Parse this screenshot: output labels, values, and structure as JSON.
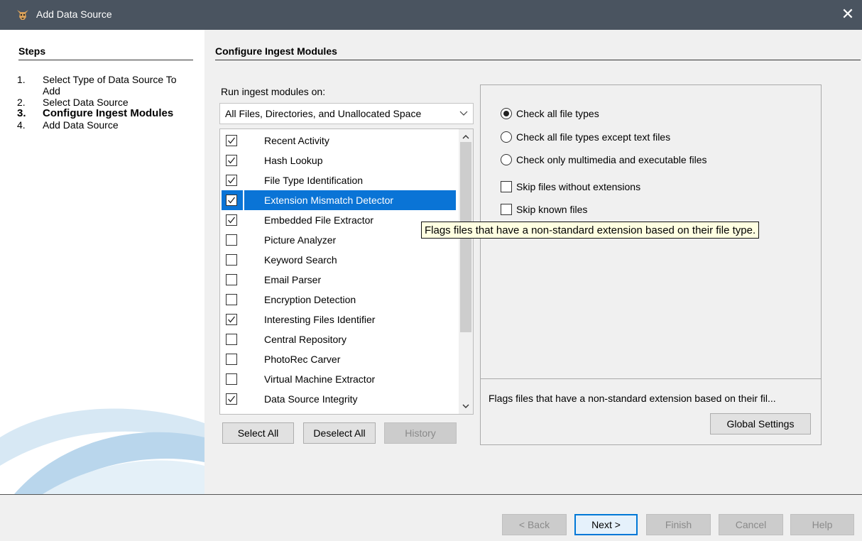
{
  "window": {
    "title": "Add Data Source",
    "close_glyph": "✕",
    "app_icon": "autopsy-dog-icon"
  },
  "steps": {
    "heading": "Steps",
    "items": [
      {
        "num": "1.",
        "label": "Select Type of Data Source To Add",
        "active": false
      },
      {
        "num": "2.",
        "label": "Select Data Source",
        "active": false
      },
      {
        "num": "3.",
        "label": "Configure Ingest Modules",
        "active": true
      },
      {
        "num": "4.",
        "label": "Add Data Source",
        "active": false
      }
    ]
  },
  "main": {
    "heading": "Configure Ingest Modules",
    "run_label": "Run ingest modules on:",
    "run_select_value": "All Files, Directories, and Unallocated Space"
  },
  "modules": [
    {
      "name": "Recent Activity",
      "checked": true,
      "selected": false
    },
    {
      "name": "Hash Lookup",
      "checked": true,
      "selected": false
    },
    {
      "name": "File Type Identification",
      "checked": true,
      "selected": false
    },
    {
      "name": "Extension Mismatch Detector",
      "checked": true,
      "selected": true
    },
    {
      "name": "Embedded File Extractor",
      "checked": true,
      "selected": false
    },
    {
      "name": "Picture Analyzer",
      "checked": false,
      "selected": false
    },
    {
      "name": "Keyword Search",
      "checked": false,
      "selected": false
    },
    {
      "name": "Email Parser",
      "checked": false,
      "selected": false
    },
    {
      "name": "Encryption Detection",
      "checked": false,
      "selected": false
    },
    {
      "name": "Interesting Files Identifier",
      "checked": true,
      "selected": false
    },
    {
      "name": "Central Repository",
      "checked": false,
      "selected": false
    },
    {
      "name": "PhotoRec Carver",
      "checked": false,
      "selected": false
    },
    {
      "name": "Virtual Machine Extractor",
      "checked": false,
      "selected": false
    },
    {
      "name": "Data Source Integrity",
      "checked": true,
      "selected": false
    }
  ],
  "list_buttons": {
    "select_all": "Select All",
    "deselect_all": "Deselect All",
    "history": "History"
  },
  "options": {
    "radio_all": "Check all file types",
    "radio_except_text": "Check all file types except text files",
    "radio_multimedia": "Check only multimedia and executable files",
    "skip_no_ext": "Skip files without extensions",
    "skip_known": "Skip known files",
    "description": "Flags files that have a non-standard extension based on their fil...",
    "global_settings": "Global Settings"
  },
  "tooltip": "Flags files that have a non-standard extension based on their file type.",
  "nav": {
    "back": "< Back",
    "next": "Next >",
    "finish": "Finish",
    "cancel": "Cancel",
    "help": "Help"
  }
}
